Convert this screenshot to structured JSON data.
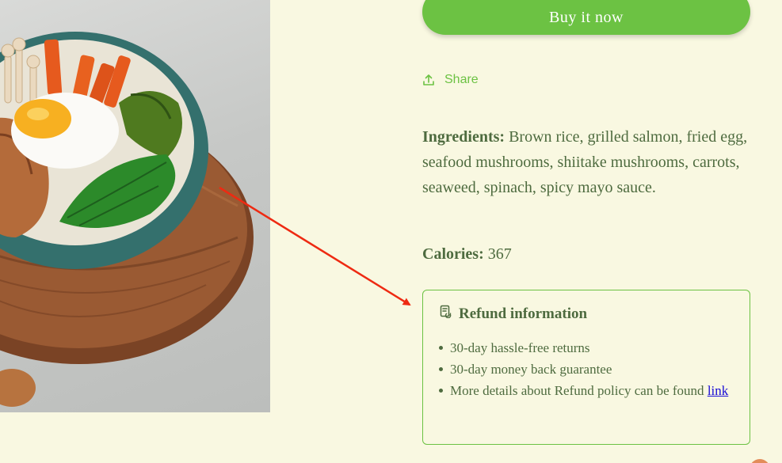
{
  "product": {
    "buy_now_label": "Buy it now",
    "share_label": "Share",
    "ingredients_label": "Ingredients:",
    "ingredients_text": "Brown rice, grilled salmon, fried egg, seafood mushrooms, shiitake mushrooms, carrots, seaweed, spinach, spicy mayo sauce.",
    "calories_label": "Calories:",
    "calories_value": "367"
  },
  "refund": {
    "title": "Refund information",
    "items": [
      "30-day hassle-free returns",
      "30-day money back guarantee"
    ],
    "details_text": "More details about Refund policy can be found",
    "link_label": "link"
  },
  "icons": {
    "share": "upload-share-icon",
    "refund": "receipt-refund-icon"
  },
  "colors": {
    "background": "#f9f8e1",
    "accent_green": "#6cc243",
    "text": "#4e6b3f",
    "link": "#1a0dd6",
    "annotation_arrow": "#ee2a12"
  }
}
